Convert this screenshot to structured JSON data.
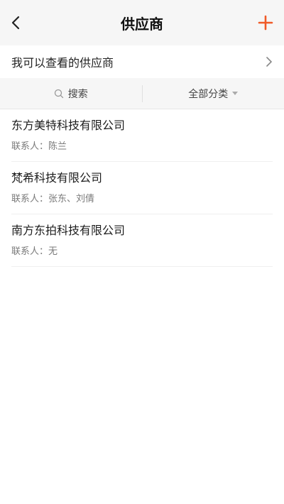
{
  "header": {
    "title": "供应商",
    "back_icon": "chevron-left-icon",
    "add_icon": "plus-icon",
    "accent_color": "#f05a28"
  },
  "visible_row": {
    "label": "我可以查看的供应商",
    "icon": "chevron-right-icon"
  },
  "filter": {
    "search_label": "搜索",
    "category_label": "全部分类"
  },
  "suppliers": [
    {
      "name": "东方美特科技有限公司",
      "contact_prefix": "联系人：",
      "contact": "陈兰"
    },
    {
      "name": "梵希科技有限公司",
      "contact_prefix": "联系人：",
      "contact": "张东、刘倩"
    },
    {
      "name": "南方东拍科技有限公司",
      "contact_prefix": "联系人：",
      "contact": "无"
    }
  ]
}
